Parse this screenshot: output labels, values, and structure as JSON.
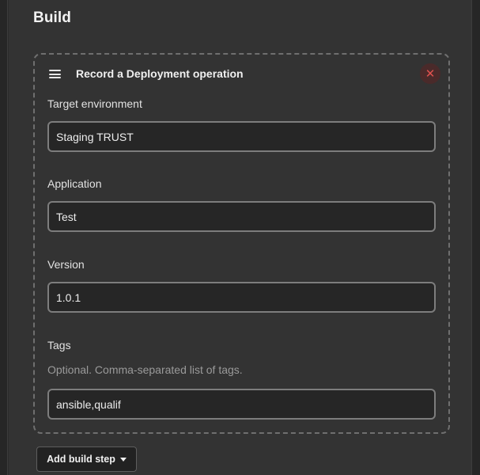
{
  "section": {
    "title": "Build"
  },
  "step": {
    "title": "Record a Deployment operation",
    "handle_icon": "drag-handle-icon",
    "delete_icon": "close-icon",
    "delete_symbol": "✕"
  },
  "fields": {
    "target_environment": {
      "label": "Target environment",
      "value": "Staging TRUST"
    },
    "application": {
      "label": "Application",
      "value": "Test"
    },
    "version": {
      "label": "Version",
      "value": "1.0.1"
    },
    "tags": {
      "label": "Tags",
      "description": "Optional. Comma-separated list of tags.",
      "value": "ansible,qualif"
    }
  },
  "actions": {
    "add_build_step_label": "Add build step",
    "caret_icon": "caret-down-icon"
  },
  "colors": {
    "background": "#333333",
    "input_background": "#262626",
    "input_border": "#7d7d7d",
    "delete_accent": "#e0524f"
  }
}
